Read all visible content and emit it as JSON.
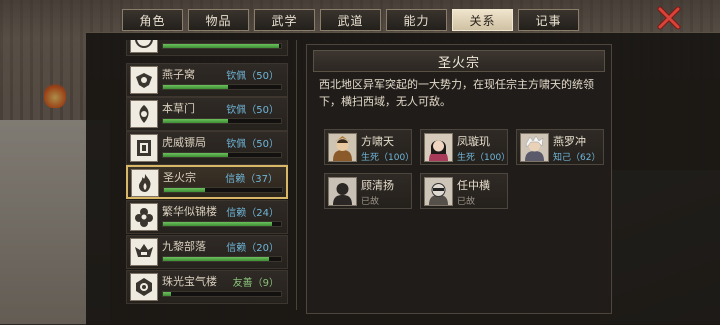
{
  "tabs": [
    {
      "label": "角色",
      "active": false
    },
    {
      "label": "物品",
      "active": false
    },
    {
      "label": "武学",
      "active": false
    },
    {
      "label": "武道",
      "active": false
    },
    {
      "label": "能力",
      "active": false
    },
    {
      "label": "关系",
      "active": true
    },
    {
      "label": "记事",
      "active": false
    }
  ],
  "factions": [
    {
      "name": "",
      "relation": "",
      "progress": 0.98,
      "icon": "faction-emblem-icon"
    },
    {
      "name": "燕子窝",
      "relation": "钦佩（50）",
      "progress": 0.55,
      "icon": "swallow-nest-emblem-icon"
    },
    {
      "name": "本草门",
      "relation": "钦佩（50）",
      "progress": 0.55,
      "icon": "herb-sect-emblem-icon"
    },
    {
      "name": "虎威镖局",
      "relation": "钦佩（50）",
      "progress": 0.55,
      "icon": "tiger-escort-emblem-icon"
    },
    {
      "name": "圣火宗",
      "relation": "信赖（37）",
      "progress": 0.35,
      "icon": "flame-sect-emblem-icon",
      "selected": true
    },
    {
      "name": "繁华似锦楼",
      "relation": "信赖（24）",
      "progress": 0.92,
      "icon": "flower-tower-emblem-icon"
    },
    {
      "name": "九黎部落",
      "relation": "信赖（20）",
      "progress": 0.9,
      "icon": "jiuli-tribe-emblem-icon"
    },
    {
      "name": "珠光宝气楼",
      "relation": "友善（9）",
      "progress": 0.07,
      "icon": "treasure-tower-emblem-icon",
      "relation_color": "green"
    }
  ],
  "detail": {
    "title": "圣火宗",
    "description": "西北地区异军突起的一大势力，在现任宗主方啸天的统领下，横扫西域，无人可敌。",
    "members": [
      {
        "name": "方啸天",
        "status": "生死（100）",
        "portrait": "male-warrior-portrait-icon"
      },
      {
        "name": "凤璇玑",
        "status": "生死（100）",
        "portrait": "female-portrait-icon"
      },
      {
        "name": "燕罗冲",
        "status": "知己（62）",
        "portrait": "white-hair-portrait-icon"
      },
      {
        "name": "顾清扬",
        "status": "已故",
        "portrait": "silhouette-portrait-icon",
        "deceased": true
      },
      {
        "name": "任中横",
        "status": "已故",
        "portrait": "masked-portrait-icon",
        "deceased": true
      }
    ]
  },
  "colors": {
    "accent": "#d9b768",
    "relation_blue": "#6fb6d9",
    "relation_green": "#88c078",
    "bar": "#5cb04c"
  }
}
